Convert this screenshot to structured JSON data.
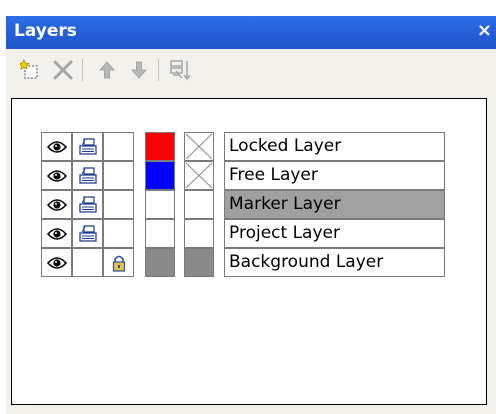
{
  "panel": {
    "title": "Layers",
    "close_glyph": "×"
  },
  "toolbar": {
    "items": [
      {
        "icon": "new-layer-icon"
      },
      {
        "icon": "delete-icon"
      },
      {
        "icon": "move-up-icon"
      },
      {
        "icon": "move-down-icon"
      },
      {
        "icon": "sort-layers-icon"
      }
    ]
  },
  "layers": [
    {
      "name": "Locked Layer",
      "visible": true,
      "printable": true,
      "locked": false,
      "color": "#ff0000",
      "symbol": "cross",
      "selected": false
    },
    {
      "name": "Free Layer",
      "visible": true,
      "printable": true,
      "locked": false,
      "color": "#0000ff",
      "symbol": "cross",
      "selected": false
    },
    {
      "name": "Marker Layer",
      "visible": true,
      "printable": true,
      "locked": false,
      "color": "#ffffff",
      "symbol": "none",
      "selected": true
    },
    {
      "name": "Project Layer",
      "visible": true,
      "printable": true,
      "locked": false,
      "color": "#ffffff",
      "symbol": "none",
      "selected": false
    },
    {
      "name": "Background Layer",
      "visible": true,
      "printable": false,
      "locked": true,
      "color": "#8a8a8a",
      "symbol": "gray",
      "selected": false
    }
  ],
  "colors": {
    "selected_row": "#a0a0a0",
    "title_bar": "#2561d9"
  }
}
